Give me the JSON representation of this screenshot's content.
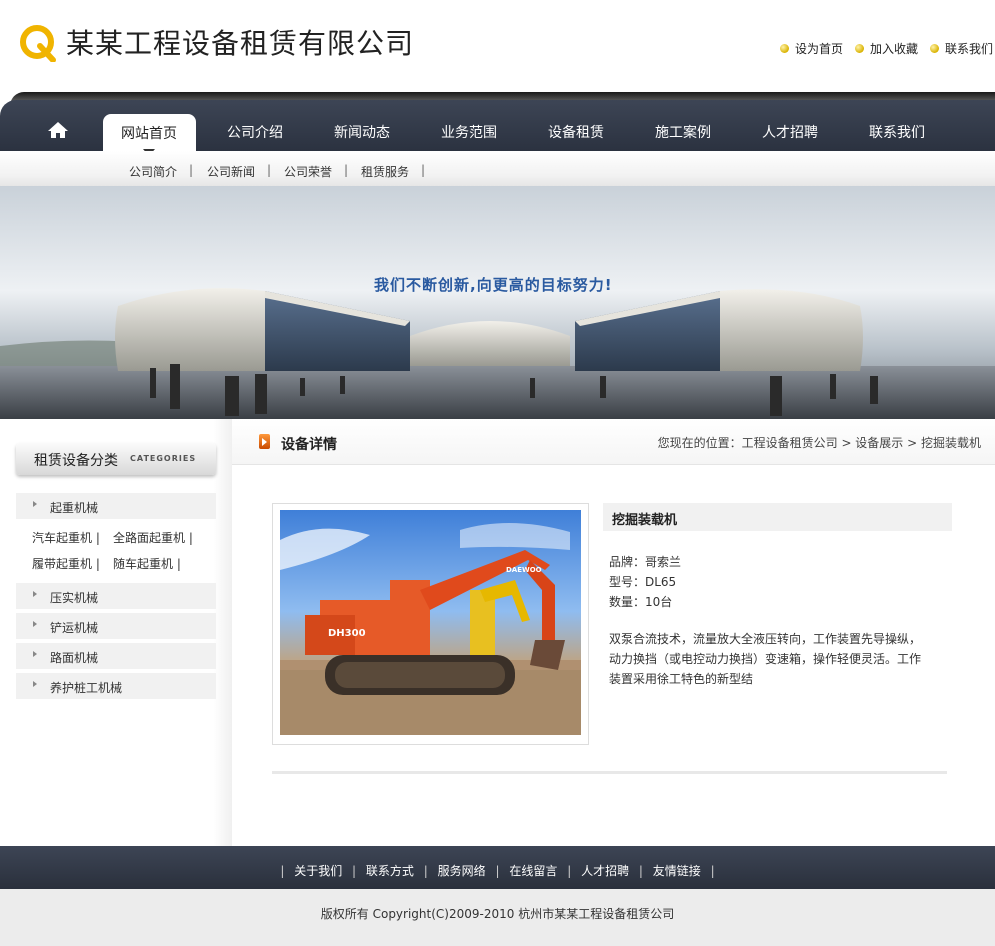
{
  "header": {
    "site_title": "某某工程设备租赁有限公司",
    "toplinks": [
      "设为首页",
      "加入收藏",
      "联系我们"
    ]
  },
  "nav": {
    "items": [
      "网站首页",
      "公司介绍",
      "新闻动态",
      "业务范围",
      "设备租赁",
      "施工案例",
      "人才招聘",
      "联系我们"
    ],
    "active": "网站首页"
  },
  "subnav": {
    "items": [
      "公司简介",
      "公司新闻",
      "公司荣誉",
      "租赁服务"
    ]
  },
  "banner": {
    "slogan": "我们不断创新,向更高的目标努力!"
  },
  "sidebar": {
    "title": "租赁设备分类",
    "subtitle": "CATEGORIES",
    "categories": [
      "起重机械",
      "压实机械",
      "铲运机械",
      "路面机械",
      "养护桩工机械"
    ],
    "subcategories": [
      "汽车起重机",
      "全路面起重机",
      "履带起重机",
      "随车起重机"
    ]
  },
  "main": {
    "title": "设备详情",
    "breadcrumb": "您现在的位置：工程设备租赁公司 > 设备展示 > 挖掘装载机"
  },
  "product": {
    "name": "挖掘装载机",
    "brand": "品牌：哥索兰",
    "model": "型号：DL65",
    "quantity": "数量：10台",
    "description": "双泵合流技术，流量放大全液压转向，工作装置先导操纵，动力换挡（或电控动力换挡）变速箱，操作轻便灵活。工作装置采用徐工特色的新型结",
    "photo_text": [
      "DAEWOO",
      "DH300"
    ]
  },
  "footer": {
    "links": [
      "关于我们",
      "联系方式",
      "服务网络",
      "在线留言",
      "人才招聘",
      "友情链接"
    ],
    "copyright": "版权所有 Copyright(C)2009-2010 杭州市某某工程设备租赁公司"
  },
  "colors": {
    "nav_bg": "#333b49",
    "accent_orange": "#e8701a",
    "slogan_blue": "#2a5aa0"
  }
}
